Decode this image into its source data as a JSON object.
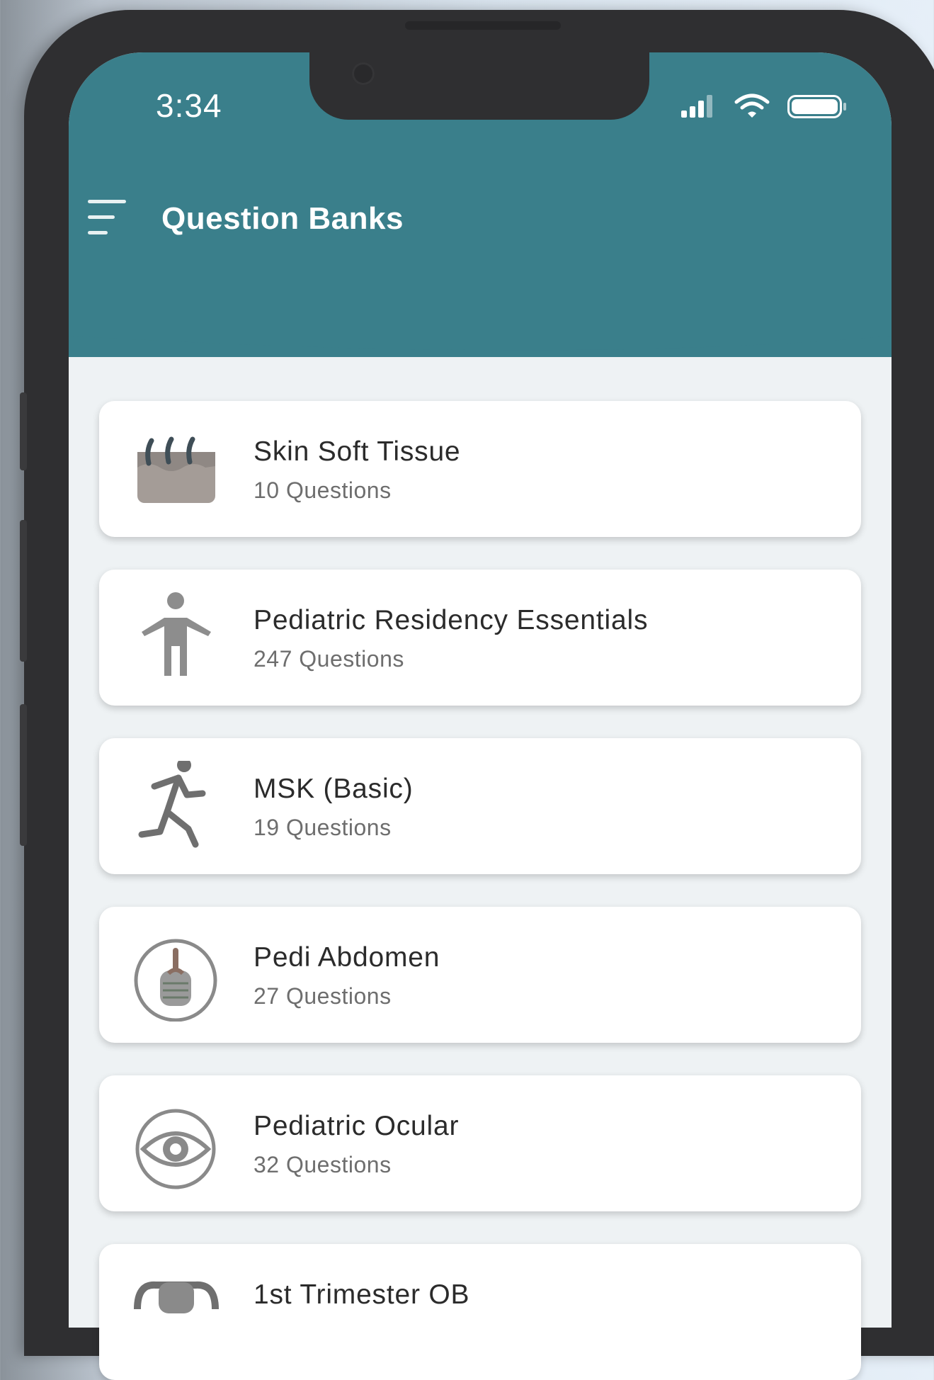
{
  "status_bar": {
    "time": "3:34",
    "icons": [
      "cellular-signal-icon",
      "wifi-icon",
      "battery-icon"
    ]
  },
  "header": {
    "menu_icon": "hamburger-menu-icon",
    "title": "Question Banks",
    "background_color": "#3a7f8b"
  },
  "question_banks": [
    {
      "title": "Skin Soft Tissue",
      "count": "10 Questions",
      "icon": "skin-tissue-icon"
    },
    {
      "title": "Pediatric Residency Essentials",
      "count": "247 Questions",
      "icon": "child-figure-icon"
    },
    {
      "title": "MSK (Basic)",
      "count": "19 Questions",
      "icon": "running-person-icon"
    },
    {
      "title": "Pedi Abdomen",
      "count": "27 Questions",
      "icon": "abdomen-icon"
    },
    {
      "title": "Pediatric Ocular",
      "count": "32 Questions",
      "icon": "eye-icon"
    },
    {
      "title": "1st Trimester OB",
      "count": "",
      "icon": "uterus-icon"
    }
  ]
}
